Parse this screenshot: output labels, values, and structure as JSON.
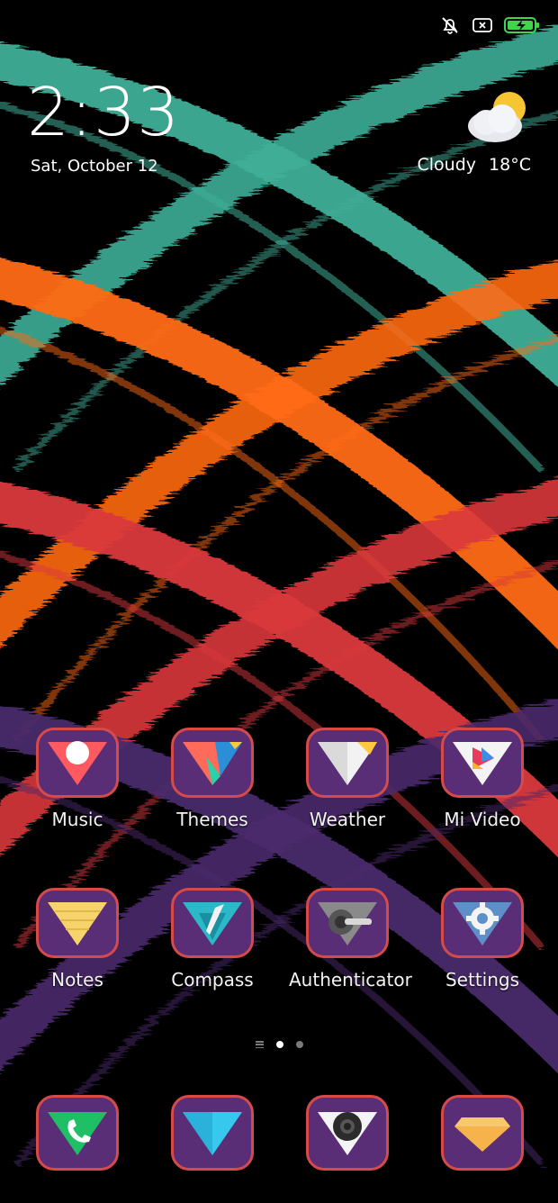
{
  "status_bar": {
    "icons": [
      "do-not-disturb-icon",
      "no-sim-icon",
      "battery-charging-icon"
    ],
    "battery_color": "#3fd64b"
  },
  "lockscreen": {
    "time": "2:33",
    "date": "Sat, October 12"
  },
  "weather": {
    "condition": "Cloudy",
    "temperature": "18°C",
    "icon": "partly-cloudy-icon"
  },
  "apps": [
    {
      "label": "Music",
      "icon": "music-icon"
    },
    {
      "label": "Themes",
      "icon": "themes-icon"
    },
    {
      "label": "Weather",
      "icon": "weather-icon"
    },
    {
      "label": "Mi Video",
      "icon": "mi-video-icon"
    },
    {
      "label": "Notes",
      "icon": "notes-icon"
    },
    {
      "label": "Compass",
      "icon": "compass-icon"
    },
    {
      "label": "Authenticator",
      "icon": "authenticator-icon"
    },
    {
      "label": "Settings",
      "icon": "settings-icon"
    }
  ],
  "page_indicator": {
    "pages": 2,
    "current": 1
  },
  "dock": [
    {
      "icon": "phone-icon"
    },
    {
      "icon": "messaging-icon"
    },
    {
      "icon": "camera-icon"
    },
    {
      "icon": "browser-icon"
    }
  ],
  "colors": {
    "icon_border": "#d64a4a",
    "icon_background": "#5a2d77",
    "stroke_teal": "#3fae97",
    "stroke_orange": "#ff6a13",
    "stroke_red": "#d9383c",
    "stroke_purple": "#4a2a6b"
  }
}
